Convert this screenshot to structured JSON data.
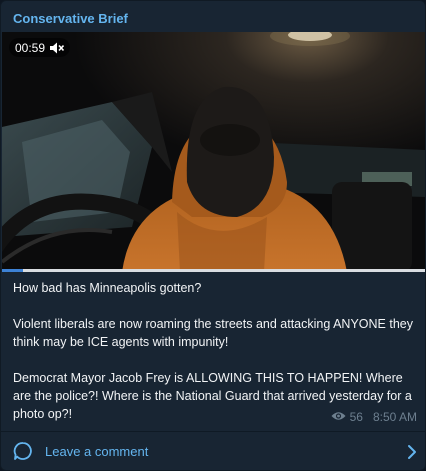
{
  "channel": {
    "name": "Conservative Brief"
  },
  "video": {
    "duration": "00:59",
    "muted_icon": "speaker-muted-icon",
    "progress_fraction": 0.05
  },
  "post": {
    "paragraphs": [
      "How bad has Minneapolis gotten?",
      "Violent liberals are now roaming the streets and attacking ANYONE they think may be ICE agents with impunity!",
      "Democrat Mayor Jacob Frey is ALLOWING THIS TO HAPPEN! Where are the police?! Where is the National Guard that arrived yesterday for a photo op?!"
    ],
    "views": "56",
    "time": "8:50 AM"
  },
  "comments": {
    "label": "Leave a comment"
  },
  "colors": {
    "background": "#182533",
    "accent": "#64b5ef",
    "progress": "#3d82d6",
    "meta_text": "#6d7f8f"
  }
}
